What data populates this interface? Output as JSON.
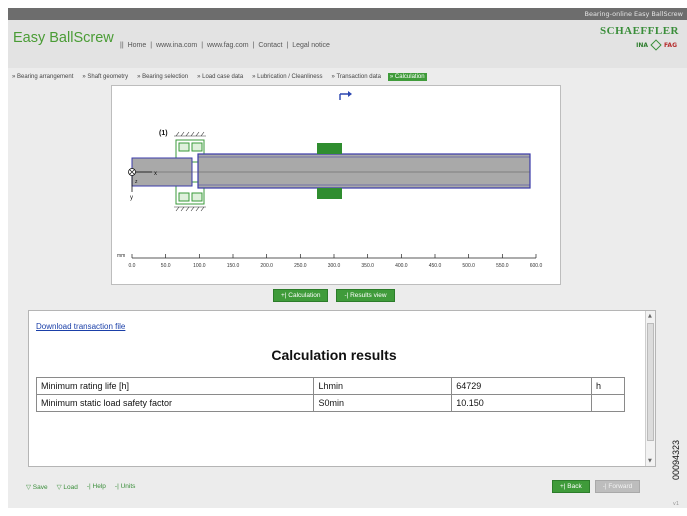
{
  "topbar": {
    "text": "Bearing-online Easy BallScrew"
  },
  "header": {
    "title": "Easy BallScrew",
    "links": [
      "||",
      "Home",
      "|",
      "www.ina.com",
      "|",
      "www.fag.com",
      "|",
      "Contact",
      "|",
      "Legal notice"
    ],
    "brand": "SCHAEFFLER",
    "logo_ina": "INA",
    "logo_fag": "FAG"
  },
  "steps": [
    {
      "label": "» Bearing arrangement",
      "active": false
    },
    {
      "label": "» Shaft geometry",
      "active": false
    },
    {
      "label": "» Bearing selection",
      "active": false
    },
    {
      "label": "» Load case data",
      "active": false
    },
    {
      "label": "» Lubrication / Cleanliness",
      "active": false
    },
    {
      "label": "» Transaction data",
      "active": false
    },
    {
      "label": "» Calculation",
      "active": true
    }
  ],
  "diagram": {
    "bearing_label": "(1)",
    "axis_x": "x",
    "axis_y": "y",
    "axis_z": "z",
    "unit": "mm",
    "ticks": [
      "0.0",
      "50.0",
      "100.0",
      "150.0",
      "200.0",
      "250.0",
      "300.0",
      "350.0",
      "400.0",
      "450.0",
      "500.0",
      "550.0",
      "600.0"
    ]
  },
  "actions": {
    "calculation": "+| Calculation",
    "results_view": "-| Results view"
  },
  "results": {
    "download_link": "Download transaction file",
    "title": "Calculation results",
    "rows": [
      {
        "name": "Minimum rating life [h]",
        "symbol": "Lhmin",
        "value": "64729",
        "unit": "h"
      },
      {
        "name": "Minimum static load safety factor",
        "symbol": "S0min",
        "value": "10.150",
        "unit": ""
      }
    ]
  },
  "footer": {
    "save": "▽ Save",
    "load": "▽ Load",
    "help": "-| Help",
    "units": "-| Units",
    "back": "+| Back",
    "forward": "-| Forward",
    "version": "v1"
  },
  "image_id": "00094323",
  "colors": {
    "accent": "#3f9b3a",
    "title": "#4a9c35",
    "shaft": "#aaaaaa",
    "outline": "#3a3aa8"
  }
}
